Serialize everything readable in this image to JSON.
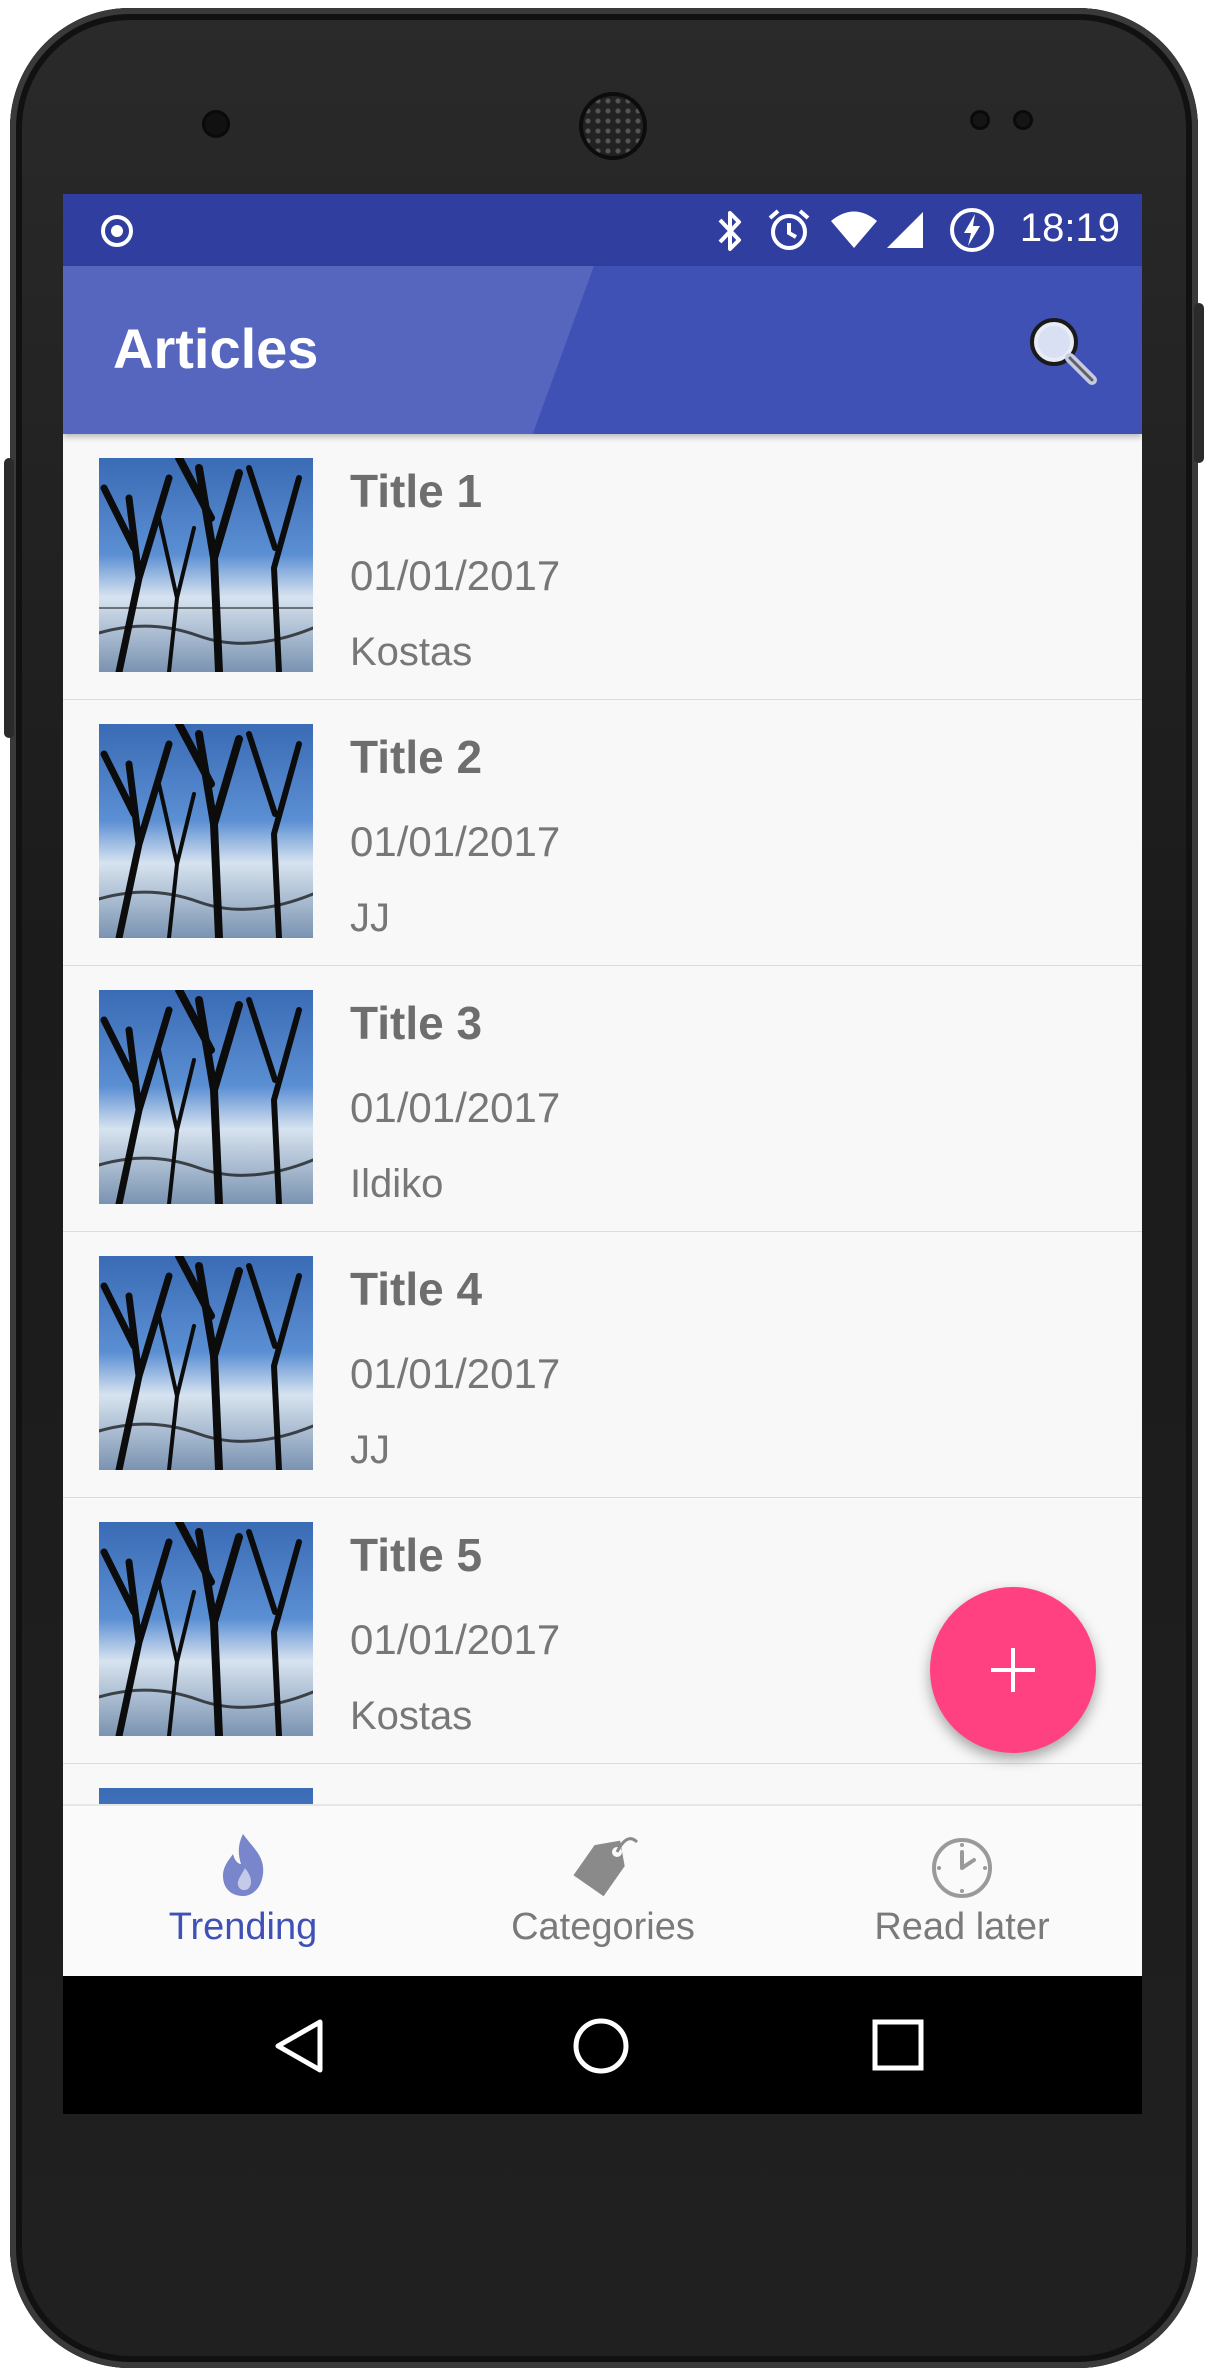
{
  "status_bar": {
    "time": "18:19",
    "icons": [
      "record-icon",
      "bluetooth-icon",
      "alarm-icon",
      "wifi-icon",
      "cell-signal-icon",
      "battery-charging-icon"
    ]
  },
  "app_bar": {
    "title": "Articles",
    "action_icon": "search-icon",
    "color": "#3f51b5",
    "status_color": "#303f9f"
  },
  "articles": [
    {
      "title": "Title 1",
      "date": "01/01/2017",
      "author": "Kostas"
    },
    {
      "title": "Title 2",
      "date": "01/01/2017",
      "author": "JJ"
    },
    {
      "title": "Title 3",
      "date": "01/01/2017",
      "author": "Ildiko"
    },
    {
      "title": "Title 4",
      "date": "01/01/2017",
      "author": "JJ"
    },
    {
      "title": "Title 5",
      "date": "01/01/2017",
      "author": "Kostas"
    }
  ],
  "fab": {
    "icon": "plus-icon",
    "color": "#ff4081"
  },
  "bottom_nav": {
    "items": [
      {
        "label": "Trending",
        "icon": "flame-icon",
        "active": true
      },
      {
        "label": "Categories",
        "icon": "tag-icon",
        "active": false
      },
      {
        "label": "Read later",
        "icon": "clock-icon",
        "active": false
      }
    ],
    "active_color": "#3f51b5",
    "inactive_color": "#8a8a8a"
  },
  "system_nav": {
    "icons": [
      "back-icon",
      "home-icon",
      "recents-icon"
    ]
  }
}
